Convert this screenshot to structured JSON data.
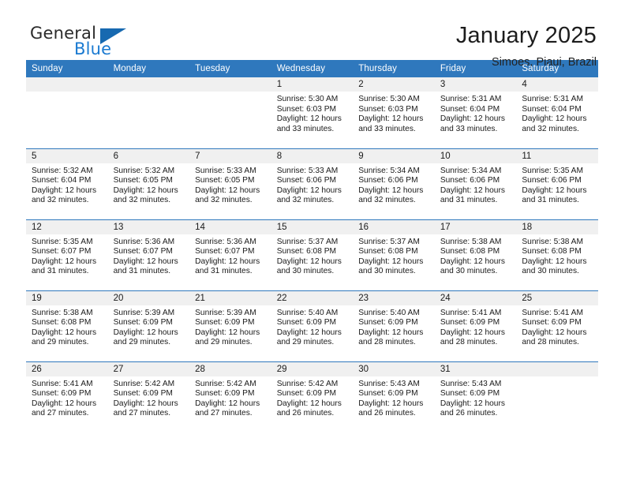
{
  "brand": {
    "word1": "General",
    "word2": "Blue",
    "triangle_color": "#1769b0",
    "blue_text_color": "#1a7ad1"
  },
  "header": {
    "title": "January 2025",
    "subtitle": "Simoes, Piaui, Brazil",
    "header_bg_color": "#2f78bd",
    "daynum_bg_color": "#f0f0f0"
  },
  "weekday_headers": [
    "Sunday",
    "Monday",
    "Tuesday",
    "Wednesday",
    "Thursday",
    "Friday",
    "Saturday"
  ],
  "labels": {
    "sunrise_prefix": "Sunrise:",
    "sunset_prefix": "Sunset:",
    "daylight_prefix": "Daylight:"
  },
  "weeks": [
    [
      {
        "day": "",
        "sunrise": "",
        "sunset": "",
        "daylight_line1": "",
        "daylight_line2": ""
      },
      {
        "day": "",
        "sunrise": "",
        "sunset": "",
        "daylight_line1": "",
        "daylight_line2": ""
      },
      {
        "day": "",
        "sunrise": "",
        "sunset": "",
        "daylight_line1": "",
        "daylight_line2": ""
      },
      {
        "day": "1",
        "sunrise": "Sunrise: 5:30 AM",
        "sunset": "Sunset: 6:03 PM",
        "daylight_line1": "Daylight: 12 hours",
        "daylight_line2": "and 33 minutes."
      },
      {
        "day": "2",
        "sunrise": "Sunrise: 5:30 AM",
        "sunset": "Sunset: 6:03 PM",
        "daylight_line1": "Daylight: 12 hours",
        "daylight_line2": "and 33 minutes."
      },
      {
        "day": "3",
        "sunrise": "Sunrise: 5:31 AM",
        "sunset": "Sunset: 6:04 PM",
        "daylight_line1": "Daylight: 12 hours",
        "daylight_line2": "and 33 minutes."
      },
      {
        "day": "4",
        "sunrise": "Sunrise: 5:31 AM",
        "sunset": "Sunset: 6:04 PM",
        "daylight_line1": "Daylight: 12 hours",
        "daylight_line2": "and 32 minutes."
      }
    ],
    [
      {
        "day": "5",
        "sunrise": "Sunrise: 5:32 AM",
        "sunset": "Sunset: 6:04 PM",
        "daylight_line1": "Daylight: 12 hours",
        "daylight_line2": "and 32 minutes."
      },
      {
        "day": "6",
        "sunrise": "Sunrise: 5:32 AM",
        "sunset": "Sunset: 6:05 PM",
        "daylight_line1": "Daylight: 12 hours",
        "daylight_line2": "and 32 minutes."
      },
      {
        "day": "7",
        "sunrise": "Sunrise: 5:33 AM",
        "sunset": "Sunset: 6:05 PM",
        "daylight_line1": "Daylight: 12 hours",
        "daylight_line2": "and 32 minutes."
      },
      {
        "day": "8",
        "sunrise": "Sunrise: 5:33 AM",
        "sunset": "Sunset: 6:06 PM",
        "daylight_line1": "Daylight: 12 hours",
        "daylight_line2": "and 32 minutes."
      },
      {
        "day": "9",
        "sunrise": "Sunrise: 5:34 AM",
        "sunset": "Sunset: 6:06 PM",
        "daylight_line1": "Daylight: 12 hours",
        "daylight_line2": "and 32 minutes."
      },
      {
        "day": "10",
        "sunrise": "Sunrise: 5:34 AM",
        "sunset": "Sunset: 6:06 PM",
        "daylight_line1": "Daylight: 12 hours",
        "daylight_line2": "and 31 minutes."
      },
      {
        "day": "11",
        "sunrise": "Sunrise: 5:35 AM",
        "sunset": "Sunset: 6:06 PM",
        "daylight_line1": "Daylight: 12 hours",
        "daylight_line2": "and 31 minutes."
      }
    ],
    [
      {
        "day": "12",
        "sunrise": "Sunrise: 5:35 AM",
        "sunset": "Sunset: 6:07 PM",
        "daylight_line1": "Daylight: 12 hours",
        "daylight_line2": "and 31 minutes."
      },
      {
        "day": "13",
        "sunrise": "Sunrise: 5:36 AM",
        "sunset": "Sunset: 6:07 PM",
        "daylight_line1": "Daylight: 12 hours",
        "daylight_line2": "and 31 minutes."
      },
      {
        "day": "14",
        "sunrise": "Sunrise: 5:36 AM",
        "sunset": "Sunset: 6:07 PM",
        "daylight_line1": "Daylight: 12 hours",
        "daylight_line2": "and 31 minutes."
      },
      {
        "day": "15",
        "sunrise": "Sunrise: 5:37 AM",
        "sunset": "Sunset: 6:08 PM",
        "daylight_line1": "Daylight: 12 hours",
        "daylight_line2": "and 30 minutes."
      },
      {
        "day": "16",
        "sunrise": "Sunrise: 5:37 AM",
        "sunset": "Sunset: 6:08 PM",
        "daylight_line1": "Daylight: 12 hours",
        "daylight_line2": "and 30 minutes."
      },
      {
        "day": "17",
        "sunrise": "Sunrise: 5:38 AM",
        "sunset": "Sunset: 6:08 PM",
        "daylight_line1": "Daylight: 12 hours",
        "daylight_line2": "and 30 minutes."
      },
      {
        "day": "18",
        "sunrise": "Sunrise: 5:38 AM",
        "sunset": "Sunset: 6:08 PM",
        "daylight_line1": "Daylight: 12 hours",
        "daylight_line2": "and 30 minutes."
      }
    ],
    [
      {
        "day": "19",
        "sunrise": "Sunrise: 5:38 AM",
        "sunset": "Sunset: 6:08 PM",
        "daylight_line1": "Daylight: 12 hours",
        "daylight_line2": "and 29 minutes."
      },
      {
        "day": "20",
        "sunrise": "Sunrise: 5:39 AM",
        "sunset": "Sunset: 6:09 PM",
        "daylight_line1": "Daylight: 12 hours",
        "daylight_line2": "and 29 minutes."
      },
      {
        "day": "21",
        "sunrise": "Sunrise: 5:39 AM",
        "sunset": "Sunset: 6:09 PM",
        "daylight_line1": "Daylight: 12 hours",
        "daylight_line2": "and 29 minutes."
      },
      {
        "day": "22",
        "sunrise": "Sunrise: 5:40 AM",
        "sunset": "Sunset: 6:09 PM",
        "daylight_line1": "Daylight: 12 hours",
        "daylight_line2": "and 29 minutes."
      },
      {
        "day": "23",
        "sunrise": "Sunrise: 5:40 AM",
        "sunset": "Sunset: 6:09 PM",
        "daylight_line1": "Daylight: 12 hours",
        "daylight_line2": "and 28 minutes."
      },
      {
        "day": "24",
        "sunrise": "Sunrise: 5:41 AM",
        "sunset": "Sunset: 6:09 PM",
        "daylight_line1": "Daylight: 12 hours",
        "daylight_line2": "and 28 minutes."
      },
      {
        "day": "25",
        "sunrise": "Sunrise: 5:41 AM",
        "sunset": "Sunset: 6:09 PM",
        "daylight_line1": "Daylight: 12 hours",
        "daylight_line2": "and 28 minutes."
      }
    ],
    [
      {
        "day": "26",
        "sunrise": "Sunrise: 5:41 AM",
        "sunset": "Sunset: 6:09 PM",
        "daylight_line1": "Daylight: 12 hours",
        "daylight_line2": "and 27 minutes."
      },
      {
        "day": "27",
        "sunrise": "Sunrise: 5:42 AM",
        "sunset": "Sunset: 6:09 PM",
        "daylight_line1": "Daylight: 12 hours",
        "daylight_line2": "and 27 minutes."
      },
      {
        "day": "28",
        "sunrise": "Sunrise: 5:42 AM",
        "sunset": "Sunset: 6:09 PM",
        "daylight_line1": "Daylight: 12 hours",
        "daylight_line2": "and 27 minutes."
      },
      {
        "day": "29",
        "sunrise": "Sunrise: 5:42 AM",
        "sunset": "Sunset: 6:09 PM",
        "daylight_line1": "Daylight: 12 hours",
        "daylight_line2": "and 26 minutes."
      },
      {
        "day": "30",
        "sunrise": "Sunrise: 5:43 AM",
        "sunset": "Sunset: 6:09 PM",
        "daylight_line1": "Daylight: 12 hours",
        "daylight_line2": "and 26 minutes."
      },
      {
        "day": "31",
        "sunrise": "Sunrise: 5:43 AM",
        "sunset": "Sunset: 6:09 PM",
        "daylight_line1": "Daylight: 12 hours",
        "daylight_line2": "and 26 minutes."
      },
      {
        "day": "",
        "sunrise": "",
        "sunset": "",
        "daylight_line1": "",
        "daylight_line2": ""
      }
    ]
  ]
}
